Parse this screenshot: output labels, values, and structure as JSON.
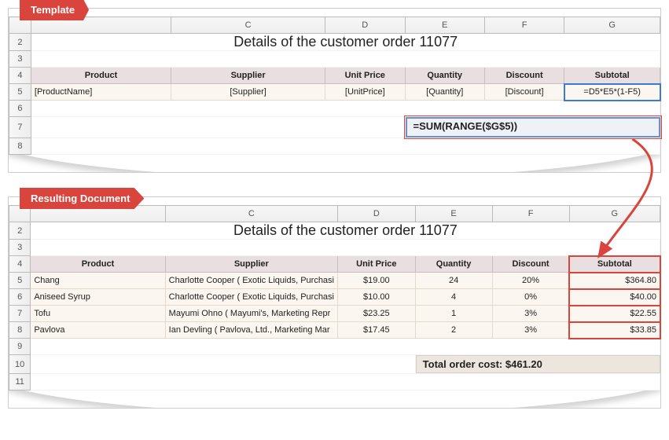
{
  "tags": {
    "template": "Template",
    "result": "Resulting Document"
  },
  "title": "Details of the customer order 11077",
  "headers": {
    "product": "Product",
    "supplier": "Supplier",
    "unitprice": "Unit Price",
    "quantity": "Quantity",
    "discount": "Discount",
    "subtotal": "Subtotal"
  },
  "cols": [
    "C",
    "D",
    "E",
    "F",
    "G"
  ],
  "template_rownums": [
    "2",
    "3",
    "4",
    "5",
    "6",
    "7",
    "8"
  ],
  "result_rownums": [
    "2",
    "3",
    "4",
    "5",
    "6",
    "7",
    "8",
    "9",
    "10",
    "11"
  ],
  "template_row": {
    "product": "[ProductName]",
    "supplier": "[Supplier]",
    "unitprice": "[UnitPrice]",
    "quantity": "[Quantity]",
    "discount": "[Discount]",
    "subtotal": "=D5*E5*(1-F5)"
  },
  "sum_formula": "=SUM(RANGE($G$5))",
  "rows": [
    {
      "product": "Chang",
      "supplier": "Charlotte Cooper ( Exotic Liquids, Purchasi",
      "unitprice": "$19.00",
      "quantity": "24",
      "discount": "20%",
      "subtotal": "$364.80"
    },
    {
      "product": "Aniseed Syrup",
      "supplier": "Charlotte Cooper ( Exotic Liquids, Purchasi",
      "unitprice": "$10.00",
      "quantity": "4",
      "discount": "0%",
      "subtotal": "$40.00"
    },
    {
      "product": "Tofu",
      "supplier": "Mayumi Ohno ( Mayumi's, Marketing Repr",
      "unitprice": "$23.25",
      "quantity": "1",
      "discount": "3%",
      "subtotal": "$22.55"
    },
    {
      "product": "Pavlova",
      "supplier": "Ian Devling ( Pavlova, Ltd., Marketing Mar",
      "unitprice": "$17.45",
      "quantity": "2",
      "discount": "3%",
      "subtotal": "$33.85"
    }
  ],
  "total_label": "Total order cost: $461.20"
}
